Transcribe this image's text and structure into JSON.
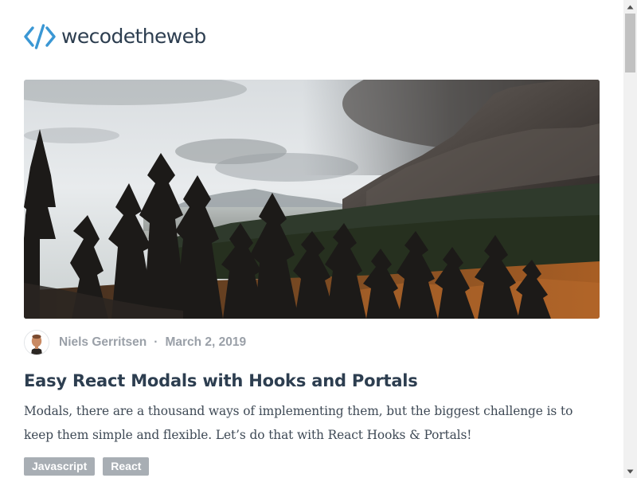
{
  "site": {
    "logo_text": "wecodetheweb",
    "logo_icon": "code-brackets-icon",
    "accent_color": "#3a97d4",
    "text_color": "#2d3e50"
  },
  "post": {
    "hero_image": "mountain-forest-landscape",
    "author": "Niels Gerritsen",
    "separator": "·",
    "date": "March 2, 2019",
    "title": "Easy React Modals with Hooks and Portals",
    "excerpt": "Modals, there are a thousand ways of implementing them, but the biggest challenge is to keep them simple and flexible. Let’s do that with React Hooks & Portals!",
    "tags": [
      {
        "label": "Javascript"
      },
      {
        "label": "React"
      }
    ],
    "tag_color": "#a8aeb4"
  },
  "scrollbar": {
    "up_icon": "scroll-up-arrow-icon",
    "down_icon": "scroll-down-arrow-icon"
  }
}
